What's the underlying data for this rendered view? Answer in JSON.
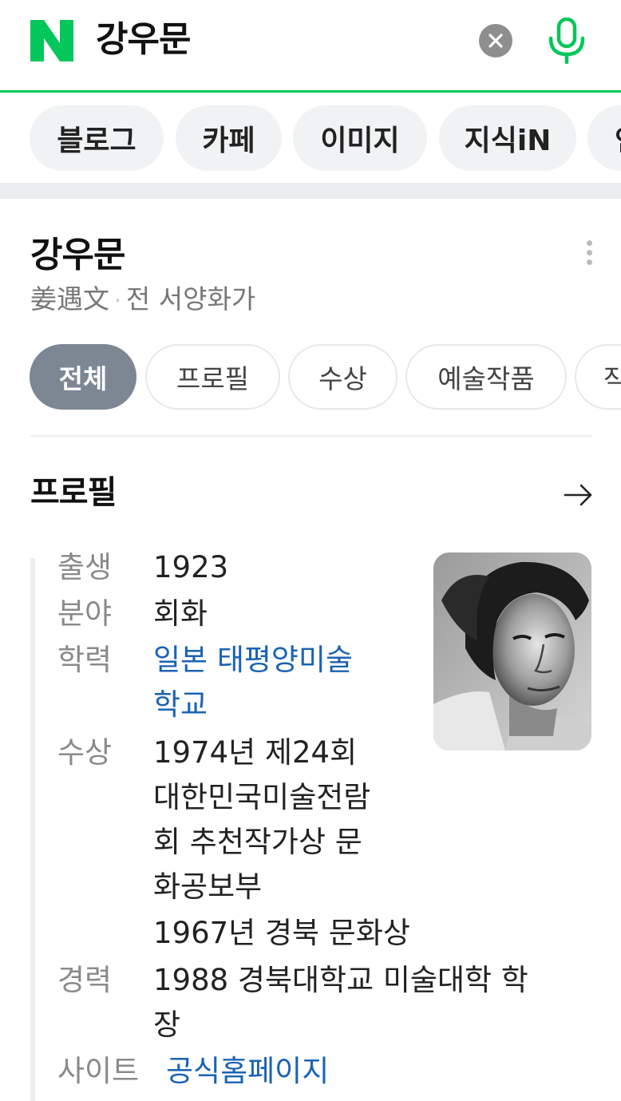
{
  "header": {
    "logo_letter": "N",
    "query": "강우문",
    "brand_color": "#03c75a"
  },
  "categories": [
    {
      "label": "블로그"
    },
    {
      "label": "카페"
    },
    {
      "label": "이미지"
    },
    {
      "label": "지식iN"
    },
    {
      "label": "인"
    }
  ],
  "entity": {
    "name": "강우문",
    "hanja": "姜遇文",
    "occupation": "전 서양화가"
  },
  "subtabs": [
    {
      "label": "전체",
      "active": true
    },
    {
      "label": "프로필",
      "active": false
    },
    {
      "label": "수상",
      "active": false
    },
    {
      "label": "예술작품",
      "active": false
    },
    {
      "label": "작",
      "active": false
    }
  ],
  "profile": {
    "title": "프로필",
    "rows": {
      "birth": {
        "label": "출생",
        "lines": [
          "1923"
        ]
      },
      "field": {
        "label": "분야",
        "lines": [
          "회화"
        ]
      },
      "education": {
        "label": "학력",
        "lines": [
          "일본 태평양미술",
          "학교"
        ]
      },
      "awards": {
        "label": "수상",
        "lines": [
          "1974년 제24회",
          "대한민국미술전람",
          "회 추천작가상 문",
          "화공보부",
          "1967년 경북 문화상"
        ]
      },
      "career": {
        "label": "경력",
        "lines": [
          "1988 경북대학교 미술대학 학",
          "장"
        ]
      },
      "site": {
        "label": "사이트",
        "lines": [
          "공식홈페이지"
        ]
      }
    }
  }
}
